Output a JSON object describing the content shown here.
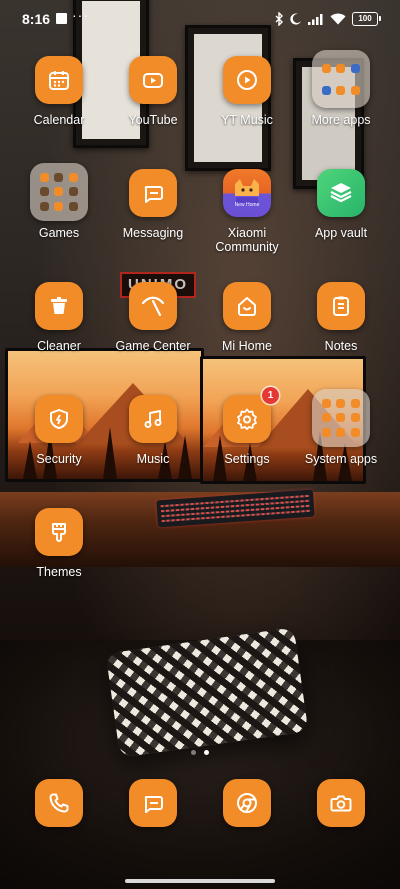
{
  "status_bar": {
    "time": "8:16",
    "more_indicator": "···",
    "battery": "100",
    "icons": [
      "bluetooth-icon",
      "moon-icon",
      "signal-icon",
      "wifi-icon",
      "battery-icon"
    ]
  },
  "apps": [
    {
      "name": "calendar",
      "label": "Calendar",
      "icon": "calendar-icon"
    },
    {
      "name": "youtube",
      "label": "YouTube",
      "icon": "youtube-icon"
    },
    {
      "name": "yt-music",
      "label": "YT Music",
      "icon": "yt-music-icon"
    },
    {
      "name": "more-apps",
      "label": "More apps",
      "icon": "folder-icon"
    },
    {
      "name": "games",
      "label": "Games",
      "icon": "folder-icon"
    },
    {
      "name": "messaging",
      "label": "Messaging",
      "icon": "message-icon"
    },
    {
      "name": "xiaomi-community",
      "label": "Xiaomi Community",
      "icon": "xiaomi-community-icon",
      "icon_text": "New Home"
    },
    {
      "name": "app-vault",
      "label": "App vault",
      "icon": "app-vault-icon"
    },
    {
      "name": "cleaner",
      "label": "Cleaner",
      "icon": "trash-icon"
    },
    {
      "name": "game-center",
      "label": "Game Center",
      "icon": "game-center-icon"
    },
    {
      "name": "mi-home",
      "label": "Mi Home",
      "icon": "home-icon"
    },
    {
      "name": "notes",
      "label": "Notes",
      "icon": "notes-icon"
    },
    {
      "name": "security",
      "label": "Security",
      "icon": "security-icon"
    },
    {
      "name": "music",
      "label": "Music",
      "icon": "music-icon"
    },
    {
      "name": "settings",
      "label": "Settings",
      "icon": "gear-icon",
      "badge": "1"
    },
    {
      "name": "system-apps",
      "label": "System apps",
      "icon": "folder-icon"
    },
    {
      "name": "themes",
      "label": "Themes",
      "icon": "themes-icon"
    }
  ],
  "wallpaper": {
    "sign_text": "UNIMO"
  },
  "pages": {
    "count": 2,
    "active": 2
  },
  "dock": [
    {
      "name": "phone",
      "icon": "phone-icon"
    },
    {
      "name": "messaging",
      "icon": "message-icon"
    },
    {
      "name": "chrome",
      "icon": "chrome-icon"
    },
    {
      "name": "camera",
      "icon": "camera-icon"
    }
  ],
  "colors": {
    "accent": "#f28c28",
    "badge": "#e53935"
  }
}
